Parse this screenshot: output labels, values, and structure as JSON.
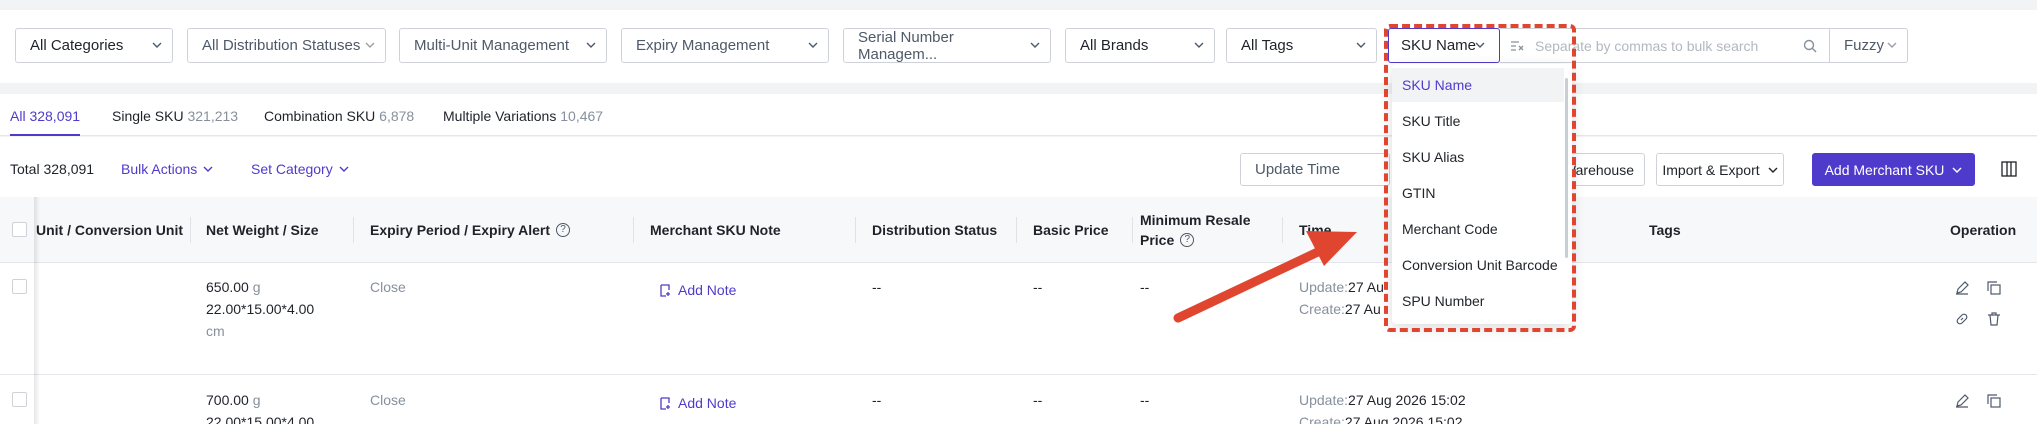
{
  "filters": {
    "categories": "All Categories",
    "distribution_statuses": "All Distribution Statuses",
    "multi_unit": "Multi-Unit Management",
    "expiry": "Expiry Management",
    "serial": "Serial Number Managem...",
    "brands": "All Brands",
    "tags": "All Tags",
    "search_field": "SKU Name",
    "search_placeholder": "Separate by commas to bulk search",
    "match_mode": "Fuzzy"
  },
  "tabs": [
    {
      "label": "All",
      "count": "328,091"
    },
    {
      "label": "Single SKU",
      "count": "321,213"
    },
    {
      "label": "Combination SKU",
      "count": "6,878"
    },
    {
      "label": "Multiple Variations",
      "count": "10,467"
    }
  ],
  "actions": {
    "total": "Total 328,091",
    "bulk_actions": "Bulk Actions",
    "set_category": "Set Category",
    "sort": "Update Time",
    "warehouse": "Warehouse",
    "import_export": "Import & Export",
    "add_sku": "Add Merchant SKU"
  },
  "table": {
    "columns": [
      "Unit / Conversion Unit",
      "Net Weight / Size",
      "Expiry Period / Expiry Alert",
      "Merchant SKU Note",
      "Distribution Status",
      "Basic Price",
      "Minimum Resale",
      "Price",
      "Time",
      "Tags",
      "Operation"
    ],
    "rows": [
      {
        "weight": "650.00",
        "weight_unit": "g",
        "size": "22.00*15.00*4.00",
        "size_unit": "cm",
        "expiry": "Close",
        "note": "Add Note",
        "dist": "--",
        "basic": "--",
        "min": "--",
        "update_label": "Update:",
        "update": "27 Au",
        "create_label": "Create:",
        "create": "27 Au"
      },
      {
        "weight": "700.00",
        "weight_unit": "g",
        "size": "22.00*15.00*4.00",
        "expiry": "Close",
        "note": "Add Note",
        "dist": "--",
        "basic": "--",
        "min": "--",
        "update_label": "Update:",
        "update": "27 Aug 2026 15:02",
        "create_label": "Create:",
        "create": "27 Aug 2026 15:02"
      }
    ]
  },
  "dropdown": {
    "options": [
      "SKU Name",
      "SKU Title",
      "SKU Alias",
      "GTIN",
      "Merchant Code",
      "Conversion Unit Barcode",
      "SPU Number"
    ]
  },
  "colors": {
    "accent": "#4f3bcb",
    "annotation": "#e0452f"
  }
}
